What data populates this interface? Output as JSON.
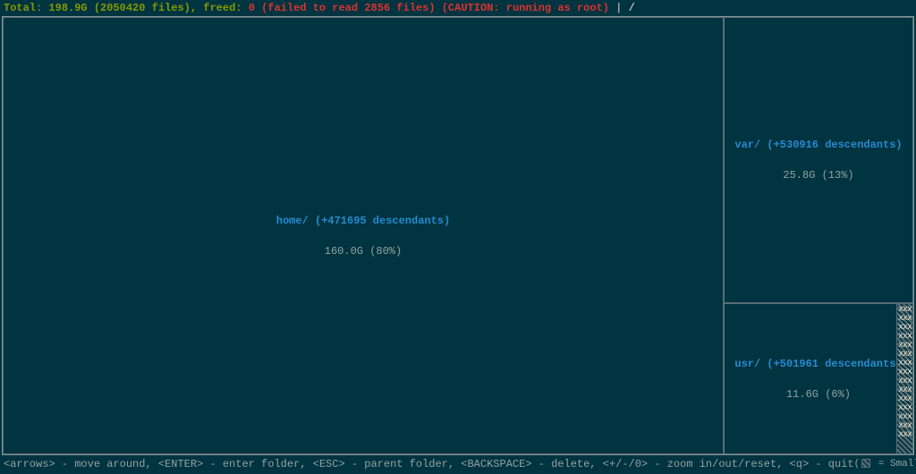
{
  "header": {
    "total_label": "Total:",
    "total_value": "198.9G (2050420 files)",
    "freed_label": "freed:",
    "freed_value": "0",
    "fail_msg": "(failed to read 2856 files)",
    "caution_msg": "(CAUTION: running as root)",
    "sep": "|",
    "path": "/"
  },
  "cells": {
    "home": {
      "name": "home/",
      "desc": "(+471695 descendants)",
      "stats": "160.0G (80%)"
    },
    "var": {
      "name": "var/",
      "desc": "(+530916 descendants)",
      "stats": "25.8G (13%)"
    },
    "usr": {
      "name": "usr/",
      "desc": "(+501961 descendants)",
      "stats": "11.6G (6%)"
    }
  },
  "smallfiles_pattern": "xxx",
  "footer": {
    "help": "<arrows> - move around, <ENTER> - enter folder, <ESC> - parent folder, <BACKSPACE> - delete, <+/-/0> - zoom in/out/reset, <q> - quit",
    "legend_prefix": "(",
    "legend_text": " = Small files)",
    "legend_icon_name": "hatch-swatch"
  }
}
